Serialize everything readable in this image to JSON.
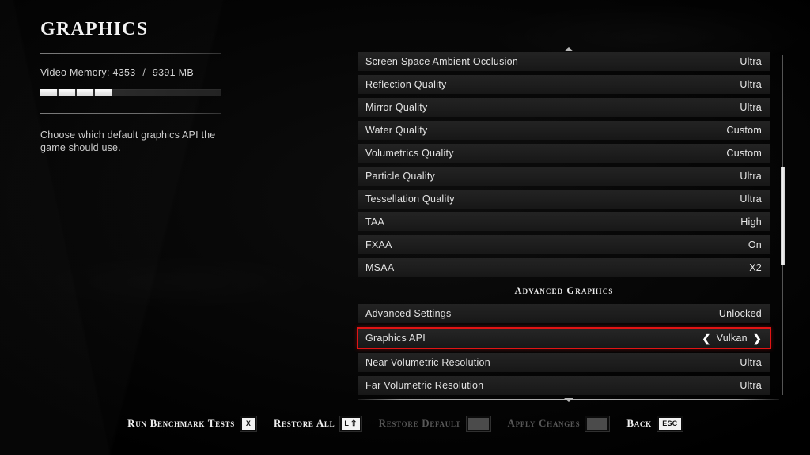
{
  "page": {
    "title": "GRAPHICS"
  },
  "left_panel": {
    "video_memory": {
      "label": "Video Memory:",
      "used": "4353",
      "separator": "/",
      "total": "9391",
      "unit": "MB",
      "segments_filled": 4,
      "segments_total": 10
    },
    "description": "Choose which default graphics API the game should use."
  },
  "settings_list": {
    "rows": [
      {
        "name": "Screen Space Ambient Occlusion",
        "value": "Ultra"
      },
      {
        "name": "Reflection Quality",
        "value": "Ultra"
      },
      {
        "name": "Mirror Quality",
        "value": "Ultra"
      },
      {
        "name": "Water Quality",
        "value": "Custom"
      },
      {
        "name": "Volumetrics Quality",
        "value": "Custom"
      },
      {
        "name": "Particle Quality",
        "value": "Ultra"
      },
      {
        "name": "Tessellation Quality",
        "value": "Ultra"
      },
      {
        "name": "TAA",
        "value": "High"
      },
      {
        "name": "FXAA",
        "value": "On"
      },
      {
        "name": "MSAA",
        "value": "X2"
      }
    ],
    "section_header": "Advanced Graphics",
    "advanced_rows": [
      {
        "name": "Advanced Settings",
        "value": "Unlocked"
      },
      {
        "name": "Near Volumetric Resolution",
        "value": "Ultra"
      },
      {
        "name": "Far Volumetric Resolution",
        "value": "Ultra"
      }
    ],
    "selected_row": {
      "name": "Graphics API",
      "value": "Vulkan",
      "prev_arrow": "❮",
      "next_arrow": "❯",
      "highlight_color": "#e11414"
    },
    "scroll_caret_up": "caret-up-icon",
    "scroll_caret_down": "caret-down-icon"
  },
  "bottom_bar": {
    "actions": [
      {
        "label": "Run Benchmark Tests",
        "key": "X",
        "key_modifier": "",
        "enabled": true
      },
      {
        "label": "Restore All",
        "key": "L",
        "key_modifier": "⇧",
        "enabled": true
      },
      {
        "label": "Restore Default",
        "key": "",
        "key_modifier": "",
        "enabled": false
      },
      {
        "label": "Apply Changes",
        "key": "",
        "key_modifier": "",
        "enabled": false
      },
      {
        "label": "Back",
        "key": "ESC",
        "key_modifier": "",
        "enabled": true
      }
    ]
  }
}
